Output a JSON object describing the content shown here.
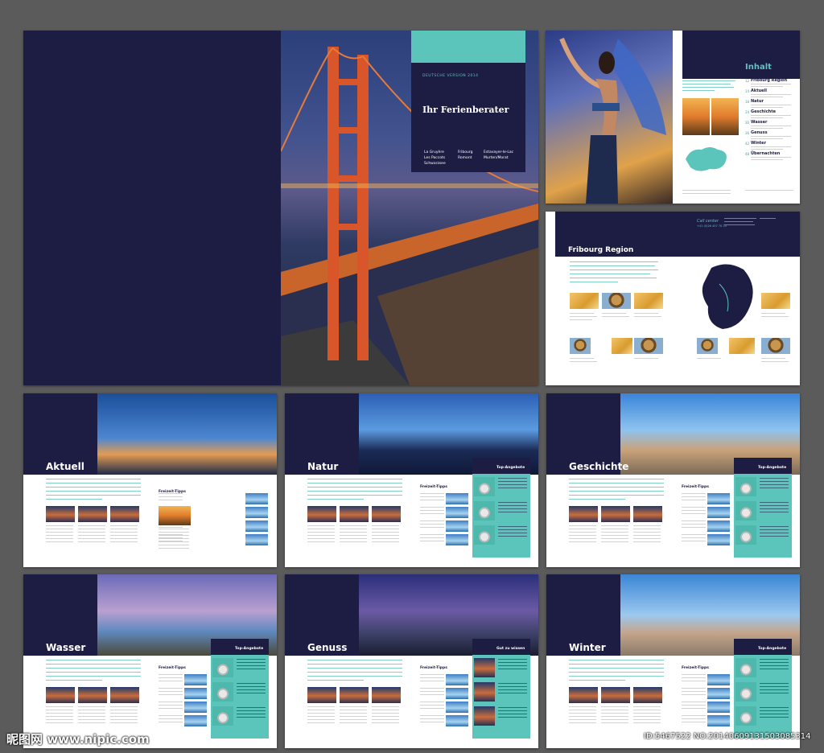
{
  "cover": {
    "edition": "DEUTSCHE VERSION 2014",
    "title": "Ihr Ferienberater",
    "col1": "La Gruyère\nLes Paccots\nSchwarzsee",
    "col2": "Fribourg\nRomont",
    "col3": "Estavayer-le-Lac\nMurten/Morat"
  },
  "inhalt": {
    "title": "Inhalt",
    "items": [
      {
        "num": "12",
        "label": "Fribourg Region"
      },
      {
        "num": "14",
        "label": "Aktuell"
      },
      {
        "num": "18",
        "label": "Natur"
      },
      {
        "num": "24",
        "label": "Geschichte"
      },
      {
        "num": "30",
        "label": "Wasser"
      },
      {
        "num": "36",
        "label": "Genuss"
      },
      {
        "num": "42",
        "label": "Winter"
      },
      {
        "num": "48",
        "label": "Übernachten"
      }
    ]
  },
  "region": {
    "title": "Fribourg Region",
    "call_label": "Call center",
    "call_number": "+41 (0)26 407 70 20"
  },
  "sections": [
    {
      "title": "Aktuell",
      "sidebar": ""
    },
    {
      "title": "Natur",
      "sidebar": "Top-Angebote"
    },
    {
      "title": "Geschichte",
      "sidebar": "Top-Angebote"
    },
    {
      "title": "Wasser",
      "sidebar": "Top-Angebote"
    },
    {
      "title": "Genuss",
      "sidebar": "Gut zu wissen"
    },
    {
      "title": "Winter",
      "sidebar": "Top-Angebote"
    }
  ],
  "freizeit_label": "Freizeit-Tipps",
  "watermark": {
    "left": "昵图网 www.nipic.com",
    "right": "ID:5467522 NO:20140609131503085314"
  },
  "colors": {
    "navy": "#1d1c43",
    "teal": "#5bc4bb",
    "background": "#5b5b5b"
  }
}
